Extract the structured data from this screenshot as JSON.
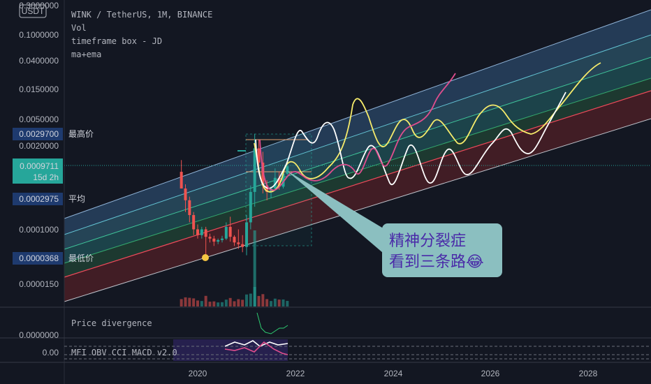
{
  "currency_label": "USDT",
  "legend": {
    "symbol": "WINK / TetherUS, 1M, BINANCE",
    "vol": "Vol",
    "indicator_1": "timeframe box - JD",
    "indicator_2": "ma+ema"
  },
  "price_axis": {
    "ticks": [
      "0.3000000",
      "0.1000000",
      "0.0400000",
      "0.0150000",
      "0.0050000",
      "0.0020000",
      "0.0001000",
      "0.0000150"
    ],
    "tick_values": [
      0.3,
      0.1,
      0.04,
      0.015,
      0.005,
      0.002,
      0.0001,
      1.5e-05
    ],
    "scale": "log"
  },
  "tags": {
    "high": {
      "value": "0.0029700",
      "label": "最高价",
      "price": 0.00297
    },
    "current": {
      "value": "0.0009711",
      "countdown": "15d 2h",
      "price": 0.0009711
    },
    "avg": {
      "value": "0.0002975",
      "label": "平均",
      "price": 0.0002975
    },
    "low": {
      "value": "0.0000368",
      "label": "最低价",
      "price": 3.68e-05
    }
  },
  "time_axis": {
    "ticks": [
      "2020",
      "2022",
      "2024",
      "2026",
      "2028"
    ]
  },
  "callout": {
    "line1": "精神分裂症",
    "line2": "看到三条路",
    "emoji": "😂"
  },
  "pane_price_divergence": {
    "label": "Price divergence",
    "axis_value": "0.0000000"
  },
  "pane_mfi": {
    "label": "MFI OBV CCI MACD v2.0",
    "axis_value": "0.00"
  },
  "colors": {
    "background": "#131722",
    "up_candle": "#26a69a",
    "down_candle": "#ef5350",
    "line_white": "#ffffff",
    "line_yellow": "#f7ec6b",
    "line_pink": "#e04e8e",
    "callout_bg": "#8bbfc0",
    "callout_text": "#4a2aa8",
    "current_tag": "#26a69a",
    "tag_bg": "#1e3a6e"
  },
  "chart_data": {
    "type": "candlestick",
    "yscale": "log",
    "ylim": [
      7.5e-06,
      0.3
    ],
    "xlim": [
      "2019-02",
      "2029-02"
    ],
    "candles": [
      {
        "date": "2019-09",
        "o": 0.0008,
        "h": 0.0012,
        "l": 0.0006,
        "c": 0.00045
      },
      {
        "date": "2019-10",
        "o": 0.00045,
        "h": 0.00052,
        "l": 0.0002,
        "c": 0.0003
      },
      {
        "date": "2019-11",
        "o": 0.0003,
        "h": 0.00034,
        "l": 0.00014,
        "c": 0.00018
      },
      {
        "date": "2019-12",
        "o": 0.00018,
        "h": 0.0002,
        "l": 9e-05,
        "c": 0.00011
      },
      {
        "date": "2020-01",
        "o": 0.00011,
        "h": 0.00013,
        "l": 8e-05,
        "c": 9e-05
      },
      {
        "date": "2020-02",
        "o": 9e-05,
        "h": 0.00012,
        "l": 8e-05,
        "c": 0.00011
      },
      {
        "date": "2020-03",
        "o": 0.00011,
        "h": 0.00012,
        "l": 3.7e-05,
        "c": 8.5e-05
      },
      {
        "date": "2020-04",
        "o": 8.5e-05,
        "h": 9.5e-05,
        "l": 7e-05,
        "c": 8e-05
      },
      {
        "date": "2020-05",
        "o": 8e-05,
        "h": 8.8e-05,
        "l": 6.2e-05,
        "c": 7.2e-05
      },
      {
        "date": "2020-06",
        "o": 7.2e-05,
        "h": 8e-05,
        "l": 6.6e-05,
        "c": 7.6e-05
      },
      {
        "date": "2020-07",
        "o": 7.6e-05,
        "h": 8.8e-05,
        "l": 7e-05,
        "c": 8e-05
      },
      {
        "date": "2020-08",
        "o": 8e-05,
        "h": 0.00014,
        "l": 7.6e-05,
        "c": 0.00012
      },
      {
        "date": "2020-09",
        "o": 0.00012,
        "h": 0.00017,
        "l": 7.2e-05,
        "c": 8.5e-05
      },
      {
        "date": "2020-10",
        "o": 8.5e-05,
        "h": 9e-05,
        "l": 6.2e-05,
        "c": 7e-05
      },
      {
        "date": "2020-11",
        "o": 7e-05,
        "h": 0.00011,
        "l": 5.6e-05,
        "c": 6.6e-05
      },
      {
        "date": "2020-12",
        "o": 6.6e-05,
        "h": 9e-05,
        "l": 5e-05,
        "c": 6e-05
      },
      {
        "date": "2021-01",
        "o": 6e-05,
        "h": 0.00018,
        "l": 4.5e-05,
        "c": 0.00014
      },
      {
        "date": "2021-02",
        "o": 0.00014,
        "h": 0.0005,
        "l": 0.00011,
        "c": 0.0004
      },
      {
        "date": "2021-03",
        "o": 0.0004,
        "h": 0.00297,
        "l": 0.00024,
        "c": 0.0018
      },
      {
        "date": "2021-04",
        "o": 0.0018,
        "h": 0.0024,
        "l": 0.00075,
        "c": 0.0011
      },
      {
        "date": "2021-05",
        "o": 0.0011,
        "h": 0.0016,
        "l": 0.00038,
        "c": 0.0005
      },
      {
        "date": "2021-06",
        "o": 0.0005,
        "h": 0.0006,
        "l": 0.0003,
        "c": 0.0004
      },
      {
        "date": "2021-07",
        "o": 0.0004,
        "h": 0.00048,
        "l": 0.00032,
        "c": 0.00045
      },
      {
        "date": "2021-08",
        "o": 0.00045,
        "h": 0.0009,
        "l": 0.00042,
        "c": 0.00065
      },
      {
        "date": "2021-09",
        "o": 0.00065,
        "h": 0.0008,
        "l": 0.00043,
        "c": 0.00048
      },
      {
        "date": "2021-10",
        "o": 0.00048,
        "h": 0.00085,
        "l": 0.00045,
        "c": 0.00075
      },
      {
        "date": "2021-11",
        "o": 0.00075,
        "h": 0.0011,
        "l": 0.00072,
        "c": 0.00097
      }
    ]
  }
}
